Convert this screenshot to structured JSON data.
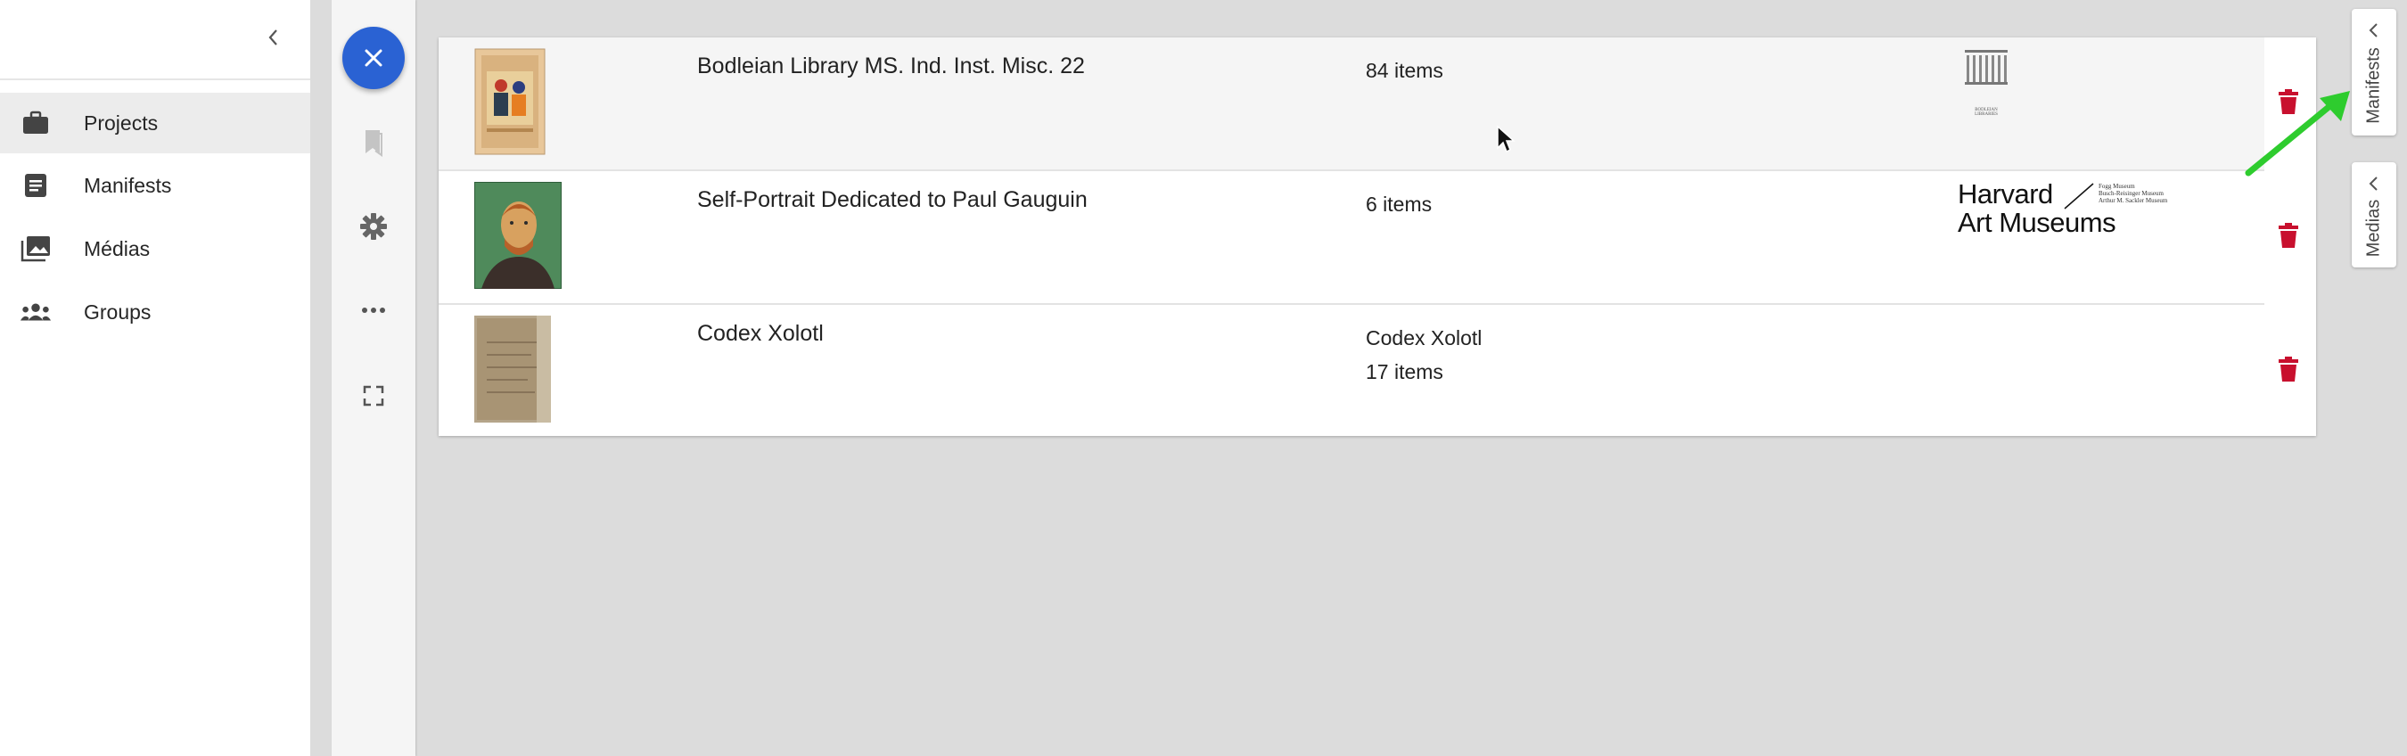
{
  "drawer": {
    "collapse_icon": "chevron-left-icon",
    "items": [
      {
        "label": "Projects",
        "icon": "briefcase-icon",
        "active": true
      },
      {
        "label": "Manifests",
        "icon": "document-icon",
        "active": false
      },
      {
        "label": "Médias",
        "icon": "photo-library-icon",
        "active": false
      },
      {
        "label": "Groups",
        "icon": "groups-icon",
        "active": false
      }
    ]
  },
  "rail": {
    "buttons": [
      "close-icon",
      "bookmark-icon",
      "gear-icon",
      "more-horizontal-icon",
      "fullscreen-icon"
    ]
  },
  "manifests": [
    {
      "title": "Bodleian Library MS. Ind. Inst. Misc. 22",
      "meta_line1": "84 items",
      "meta_line2": "",
      "logo": "Bodleian Libraries logo",
      "logo_caption": "BODLEIAN LIBRARIES",
      "thumbnail": "illuminated manuscript page"
    },
    {
      "title": "Self-Portrait Dedicated to Paul Gauguin",
      "meta_line1": "6 items",
      "meta_line2": "",
      "logo_text_line1": "Harvard",
      "logo_text_line2": "Art Museums",
      "logo_small_lines": [
        "Fogg Museum",
        "Busch-Reisinger Museum",
        "Arthur M. Sackler Museum"
      ],
      "thumbnail": "self-portrait painting"
    },
    {
      "title": "Codex Xolotl",
      "meta_line1": "Codex Xolotl",
      "meta_line2": "17 items",
      "thumbnail": "aged codex page"
    }
  ],
  "side_tabs": [
    {
      "label": "Manifests",
      "icon": "chevron-left-icon"
    },
    {
      "label": "Medias",
      "icon": "chevron-left-icon"
    }
  ],
  "colors": {
    "accent": "#2a62d3",
    "delete": "#c8102e",
    "annotation_arrow": "#2ecc2e"
  }
}
